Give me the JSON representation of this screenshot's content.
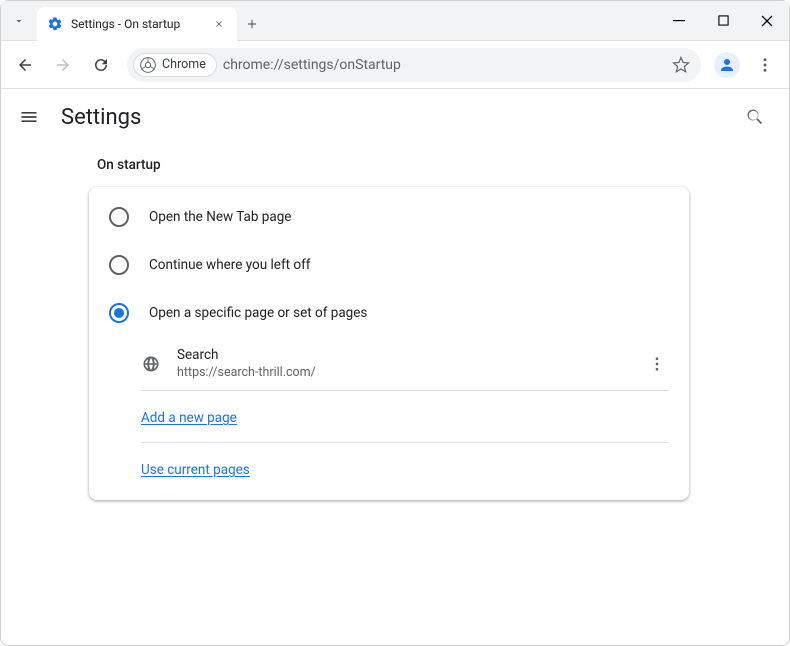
{
  "window": {
    "tab_title": "Settings - On startup"
  },
  "omnibox": {
    "chip_label": "Chrome",
    "url": "chrome://settings/onStartup"
  },
  "header": {
    "title": "Settings"
  },
  "section": {
    "label": "On startup"
  },
  "options": {
    "new_tab": "Open the New Tab page",
    "continue": "Continue where you left off",
    "specific": "Open a specific page or set of pages"
  },
  "pages": [
    {
      "name": "Search",
      "url": "https://search-thrill.com/"
    }
  ],
  "actions": {
    "add_page": "Add a new page",
    "use_current": "Use current pages"
  }
}
